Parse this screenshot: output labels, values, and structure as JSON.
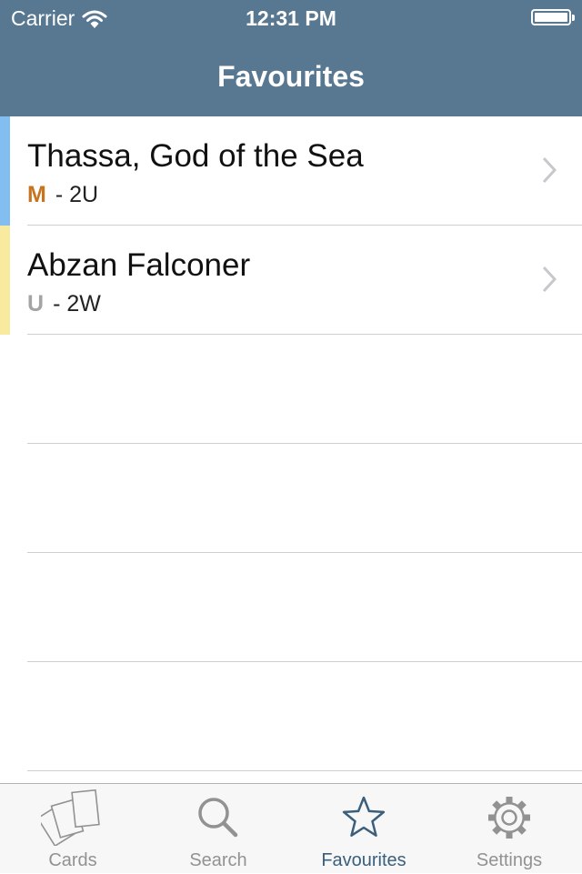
{
  "status": {
    "carrier": "Carrier",
    "time": "12:31 PM"
  },
  "nav": {
    "title": "Favourites"
  },
  "favourites": [
    {
      "name": "Thassa, God of the Sea",
      "rarity": "M",
      "rarity_color": "#c8731e",
      "cost": "2U",
      "stripe_color": "#82bff0"
    },
    {
      "name": "Abzan Falconer",
      "rarity": "U",
      "rarity_color": "#a4a4a4",
      "cost": "2W",
      "stripe_color": "#f8eba0"
    }
  ],
  "tabs": [
    {
      "label": "Cards",
      "icon": "cards-icon",
      "active": false
    },
    {
      "label": "Search",
      "icon": "search-icon",
      "active": false
    },
    {
      "label": "Favourites",
      "icon": "star-icon",
      "active": true
    },
    {
      "label": "Settings",
      "icon": "gear-icon",
      "active": false
    }
  ],
  "colors": {
    "bar": "#587892",
    "tab_active": "#3a5f7d",
    "tab_inactive": "#929292"
  }
}
